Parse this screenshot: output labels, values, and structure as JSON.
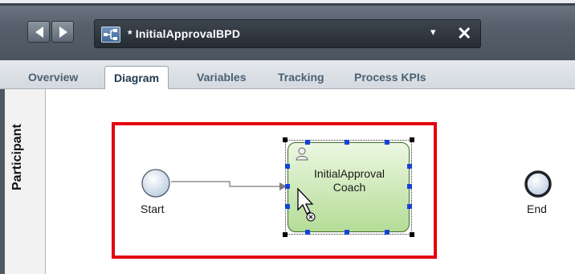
{
  "toolbar": {
    "back_icon": "triangle-left-icon",
    "forward_icon": "triangle-right-icon",
    "document_title": "* InitialApprovalBPD",
    "dropdown_glyph": "▾",
    "close_glyph": "✕"
  },
  "tabs": [
    {
      "label": "Overview",
      "active": false
    },
    {
      "label": "Diagram",
      "active": true
    },
    {
      "label": "Variables",
      "active": false
    },
    {
      "label": "Tracking",
      "active": false
    },
    {
      "label": "Process KPIs",
      "active": false
    }
  ],
  "diagram": {
    "lane_label": "Participant",
    "start_label": "Start",
    "task_line1": "InitialApproval",
    "task_line2": "Coach",
    "end_label": "End",
    "highlight_color": "#e3000f",
    "task_color": "#b4dc96"
  }
}
